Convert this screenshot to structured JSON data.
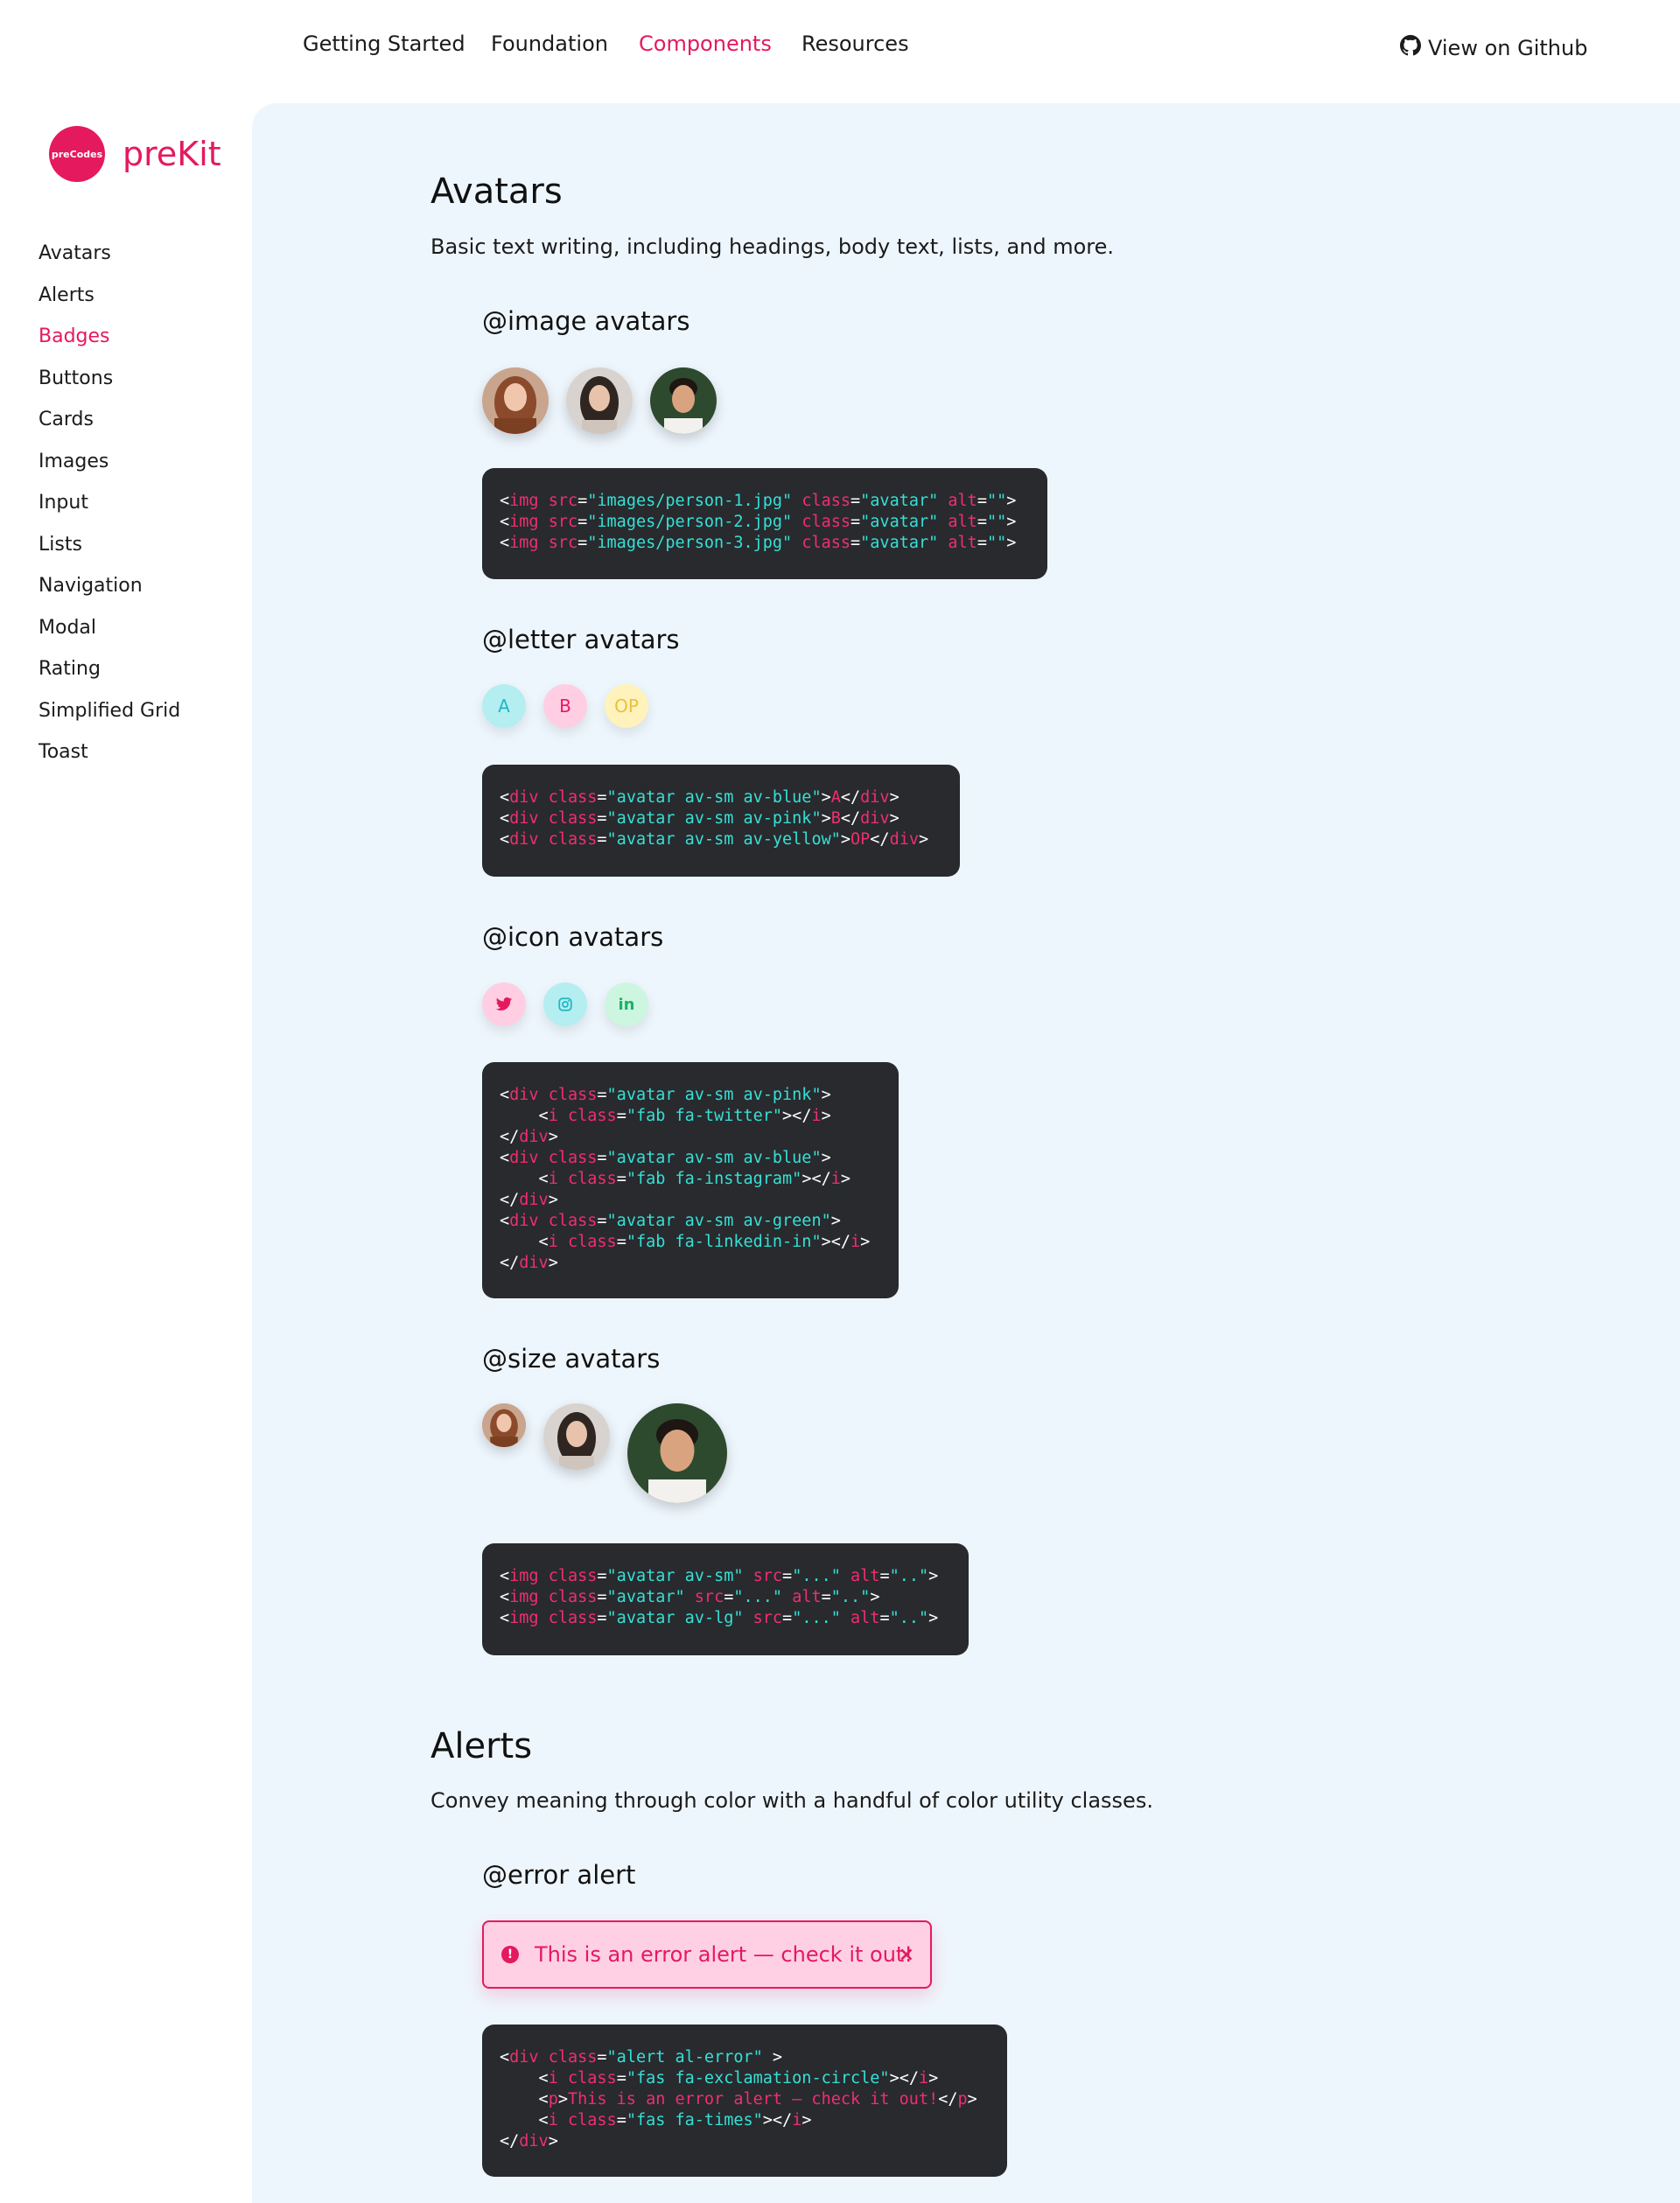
{
  "nav": {
    "links": [
      "Getting Started",
      "Foundation",
      "Components",
      "Resources"
    ],
    "active": "Components",
    "github": "View on Github"
  },
  "brand": {
    "logo_text": "preCodes",
    "name": "preKit"
  },
  "sidebar": {
    "items": [
      "Avatars",
      "Alerts",
      "Badges",
      "Buttons",
      "Cards",
      "Images",
      "Input",
      "Lists",
      "Navigation",
      "Modal",
      "Rating",
      "Simplified Grid",
      "Toast"
    ],
    "active": "Badges"
  },
  "avatars": {
    "title": "Avatars",
    "desc": "Basic text writing, including headings, body text, lists, and more.",
    "image": {
      "title": "@image avatars",
      "code": [
        [
          [
            "pun",
            "<"
          ],
          [
            "tag",
            "img"
          ],
          [
            "pun",
            " "
          ],
          [
            "attr",
            "src"
          ],
          [
            "pun",
            "="
          ],
          [
            "str",
            "\"images/person-1.jpg\""
          ],
          [
            "pun",
            " "
          ],
          [
            "attr",
            "class"
          ],
          [
            "pun",
            "="
          ],
          [
            "str",
            "\"avatar\""
          ],
          [
            "pun",
            " "
          ],
          [
            "attr",
            "alt"
          ],
          [
            "pun",
            "="
          ],
          [
            "str",
            "\"\""
          ],
          [
            "pun",
            ">"
          ]
        ],
        [
          [
            "pun",
            "<"
          ],
          [
            "tag",
            "img"
          ],
          [
            "pun",
            " "
          ],
          [
            "attr",
            "src"
          ],
          [
            "pun",
            "="
          ],
          [
            "str",
            "\"images/person-2.jpg\""
          ],
          [
            "pun",
            " "
          ],
          [
            "attr",
            "class"
          ],
          [
            "pun",
            "="
          ],
          [
            "str",
            "\"avatar\""
          ],
          [
            "pun",
            " "
          ],
          [
            "attr",
            "alt"
          ],
          [
            "pun",
            "="
          ],
          [
            "str",
            "\"\""
          ],
          [
            "pun",
            ">"
          ]
        ],
        [
          [
            "pun",
            "<"
          ],
          [
            "tag",
            "img"
          ],
          [
            "pun",
            " "
          ],
          [
            "attr",
            "src"
          ],
          [
            "pun",
            "="
          ],
          [
            "str",
            "\"images/person-3.jpg\""
          ],
          [
            "pun",
            " "
          ],
          [
            "attr",
            "class"
          ],
          [
            "pun",
            "="
          ],
          [
            "str",
            "\"avatar\""
          ],
          [
            "pun",
            " "
          ],
          [
            "attr",
            "alt"
          ],
          [
            "pun",
            "="
          ],
          [
            "str",
            "\"\""
          ],
          [
            "pun",
            ">"
          ]
        ]
      ]
    },
    "letter": {
      "title": "@letter avatars",
      "letters": [
        {
          "text": "A",
          "color": "blue"
        },
        {
          "text": "B",
          "color": "pink"
        },
        {
          "text": "OP",
          "color": "yellow"
        }
      ],
      "code": [
        [
          [
            "pun",
            "<"
          ],
          [
            "tag",
            "div"
          ],
          [
            "pun",
            " "
          ],
          [
            "attr",
            "class"
          ],
          [
            "pun",
            "="
          ],
          [
            "str",
            "\"avatar av-sm av-blue\""
          ],
          [
            "pun",
            ">"
          ],
          [
            "tag",
            "A"
          ],
          [
            "pun",
            "</"
          ],
          [
            "tag",
            "div"
          ],
          [
            "pun",
            ">"
          ]
        ],
        [
          [
            "pun",
            "<"
          ],
          [
            "tag",
            "div"
          ],
          [
            "pun",
            " "
          ],
          [
            "attr",
            "class"
          ],
          [
            "pun",
            "="
          ],
          [
            "str",
            "\"avatar av-sm av-pink\""
          ],
          [
            "pun",
            ">"
          ],
          [
            "tag",
            "B"
          ],
          [
            "pun",
            "</"
          ],
          [
            "tag",
            "div"
          ],
          [
            "pun",
            ">"
          ]
        ],
        [
          [
            "pun",
            "<"
          ],
          [
            "tag",
            "div"
          ],
          [
            "pun",
            " "
          ],
          [
            "attr",
            "class"
          ],
          [
            "pun",
            "="
          ],
          [
            "str",
            "\"avatar av-sm av-yellow\""
          ],
          [
            "pun",
            ">"
          ],
          [
            "tag",
            "OP"
          ],
          [
            "pun",
            "</"
          ],
          [
            "tag",
            "div"
          ],
          [
            "pun",
            ">"
          ]
        ]
      ]
    },
    "icon": {
      "title": "@icon avatars",
      "icons": [
        {
          "name": "twitter-icon",
          "glyph": "🐦",
          "color": "pink"
        },
        {
          "name": "instagram-icon",
          "glyph": "◎",
          "color": "blue"
        },
        {
          "name": "linkedin-icon",
          "glyph": "in",
          "color": "green"
        }
      ],
      "code": [
        [
          [
            "pun",
            "<"
          ],
          [
            "tag",
            "div"
          ],
          [
            "pun",
            " "
          ],
          [
            "attr",
            "class"
          ],
          [
            "pun",
            "="
          ],
          [
            "str",
            "\"avatar av-sm av-pink\""
          ],
          [
            "pun",
            ">"
          ]
        ],
        [
          [
            "pun",
            "    <"
          ],
          [
            "tag",
            "i"
          ],
          [
            "pun",
            " "
          ],
          [
            "attr",
            "class"
          ],
          [
            "pun",
            "="
          ],
          [
            "str",
            "\"fab fa-twitter\""
          ],
          [
            "pun",
            "></"
          ],
          [
            "tag",
            "i"
          ],
          [
            "pun",
            ">"
          ]
        ],
        [
          [
            "pun",
            "</"
          ],
          [
            "tag",
            "div"
          ],
          [
            "pun",
            ">"
          ]
        ],
        [
          [
            "pun",
            "<"
          ],
          [
            "tag",
            "div"
          ],
          [
            "pun",
            " "
          ],
          [
            "attr",
            "class"
          ],
          [
            "pun",
            "="
          ],
          [
            "str",
            "\"avatar av-sm av-blue\""
          ],
          [
            "pun",
            ">"
          ]
        ],
        [
          [
            "pun",
            "    <"
          ],
          [
            "tag",
            "i"
          ],
          [
            "pun",
            " "
          ],
          [
            "attr",
            "class"
          ],
          [
            "pun",
            "="
          ],
          [
            "str",
            "\"fab fa-instagram\""
          ],
          [
            "pun",
            "></"
          ],
          [
            "tag",
            "i"
          ],
          [
            "pun",
            ">"
          ]
        ],
        [
          [
            "pun",
            "</"
          ],
          [
            "tag",
            "div"
          ],
          [
            "pun",
            ">"
          ]
        ],
        [
          [
            "pun",
            "<"
          ],
          [
            "tag",
            "div"
          ],
          [
            "pun",
            " "
          ],
          [
            "attr",
            "class"
          ],
          [
            "pun",
            "="
          ],
          [
            "str",
            "\"avatar av-sm av-green\""
          ],
          [
            "pun",
            ">"
          ]
        ],
        [
          [
            "pun",
            "    <"
          ],
          [
            "tag",
            "i"
          ],
          [
            "pun",
            " "
          ],
          [
            "attr",
            "class"
          ],
          [
            "pun",
            "="
          ],
          [
            "str",
            "\"fab fa-linkedin-in\""
          ],
          [
            "pun",
            "></"
          ],
          [
            "tag",
            "i"
          ],
          [
            "pun",
            ">"
          ]
        ],
        [
          [
            "pun",
            "</"
          ],
          [
            "tag",
            "div"
          ],
          [
            "pun",
            ">"
          ]
        ]
      ]
    },
    "size": {
      "title": "@size avatars",
      "code": [
        [
          [
            "pun",
            "<"
          ],
          [
            "tag",
            "img"
          ],
          [
            "pun",
            " "
          ],
          [
            "attr",
            "class"
          ],
          [
            "pun",
            "="
          ],
          [
            "str",
            "\"avatar av-sm\""
          ],
          [
            "pun",
            " "
          ],
          [
            "attr",
            "src"
          ],
          [
            "pun",
            "="
          ],
          [
            "str",
            "\"...\""
          ],
          [
            "pun",
            " "
          ],
          [
            "attr",
            "alt"
          ],
          [
            "pun",
            "="
          ],
          [
            "str",
            "\"..\""
          ],
          [
            "pun",
            ">"
          ]
        ],
        [
          [
            "pun",
            "<"
          ],
          [
            "tag",
            "img"
          ],
          [
            "pun",
            " "
          ],
          [
            "attr",
            "class"
          ],
          [
            "pun",
            "="
          ],
          [
            "str",
            "\"avatar\""
          ],
          [
            "pun",
            " "
          ],
          [
            "attr",
            "src"
          ],
          [
            "pun",
            "="
          ],
          [
            "str",
            "\"...\""
          ],
          [
            "pun",
            " "
          ],
          [
            "attr",
            "alt"
          ],
          [
            "pun",
            "="
          ],
          [
            "str",
            "\"..\""
          ],
          [
            "pun",
            ">"
          ]
        ],
        [
          [
            "pun",
            "<"
          ],
          [
            "tag",
            "img"
          ],
          [
            "pun",
            " "
          ],
          [
            "attr",
            "class"
          ],
          [
            "pun",
            "="
          ],
          [
            "str",
            "\"avatar av-lg\""
          ],
          [
            "pun",
            " "
          ],
          [
            "attr",
            "src"
          ],
          [
            "pun",
            "="
          ],
          [
            "str",
            "\"...\""
          ],
          [
            "pun",
            " "
          ],
          [
            "attr",
            "alt"
          ],
          [
            "pun",
            "="
          ],
          [
            "str",
            "\"..\""
          ],
          [
            "pun",
            ">"
          ]
        ]
      ]
    }
  },
  "alerts": {
    "title": "Alerts",
    "desc": "Convey meaning through color with a handful of color utility classes.",
    "error": {
      "title": "@error alert",
      "message": "This is an error alert — check it out!",
      "close": "×",
      "code": [
        [
          [
            "pun",
            "<"
          ],
          [
            "tag",
            "div"
          ],
          [
            "pun",
            " "
          ],
          [
            "attr",
            "class"
          ],
          [
            "pun",
            "="
          ],
          [
            "str",
            "\"alert al-error\""
          ],
          [
            "pun",
            " >"
          ]
        ],
        [
          [
            "pun",
            "    <"
          ],
          [
            "tag",
            "i"
          ],
          [
            "pun",
            " "
          ],
          [
            "attr",
            "class"
          ],
          [
            "pun",
            "="
          ],
          [
            "str",
            "\"fas fa-exclamation-circle\""
          ],
          [
            "pun",
            "></"
          ],
          [
            "tag",
            "i"
          ],
          [
            "pun",
            ">"
          ]
        ],
        [
          [
            "pun",
            "    <"
          ],
          [
            "tag",
            "p"
          ],
          [
            "pun",
            ">"
          ],
          [
            "tag",
            "This is an error alert — check it out!"
          ],
          [
            "pun",
            "</"
          ],
          [
            "tag",
            "p"
          ],
          [
            "pun",
            ">"
          ]
        ],
        [
          [
            "pun",
            "    <"
          ],
          [
            "tag",
            "i"
          ],
          [
            "pun",
            " "
          ],
          [
            "attr",
            "class"
          ],
          [
            "pun",
            "="
          ],
          [
            "str",
            "\"fas fa-times\""
          ],
          [
            "pun",
            "></"
          ],
          [
            "tag",
            "i"
          ],
          [
            "pun",
            ">"
          ]
        ],
        [
          [
            "pun",
            "</"
          ],
          [
            "tag",
            "div"
          ],
          [
            "pun",
            ">"
          ]
        ]
      ]
    }
  }
}
